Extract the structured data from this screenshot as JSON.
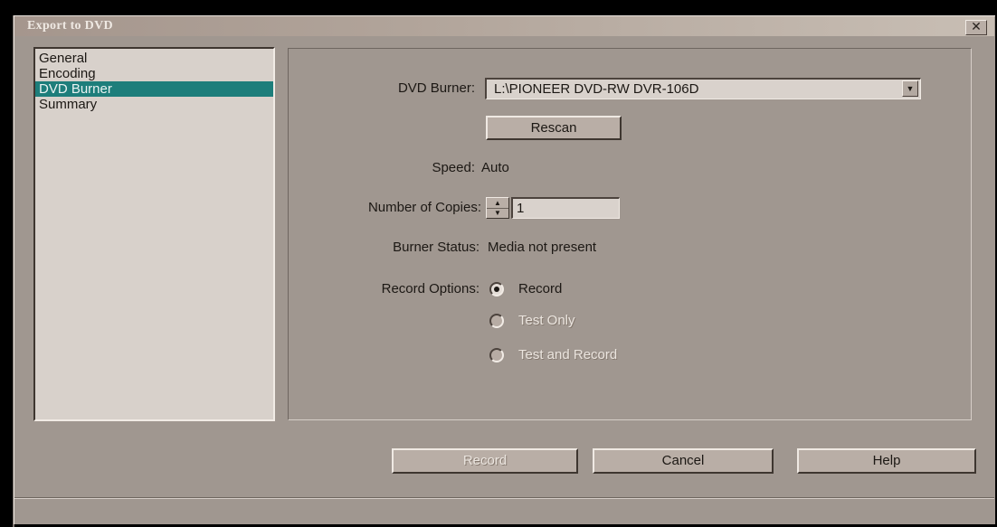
{
  "window": {
    "title": "Export to DVD",
    "close_glyph": "✕"
  },
  "nav": {
    "items": [
      {
        "label": "General",
        "selected": false
      },
      {
        "label": "Encoding",
        "selected": false
      },
      {
        "label": "DVD Burner",
        "selected": true
      },
      {
        "label": "Summary",
        "selected": false
      }
    ]
  },
  "burner": {
    "label": "DVD Burner:",
    "selected_value": "L:\\PIONEER DVD-RW  DVR-106D",
    "rescan_label": "Rescan"
  },
  "speed": {
    "label": "Speed:",
    "value": "Auto"
  },
  "copies": {
    "label": "Number of Copies:",
    "value": "1"
  },
  "status": {
    "label": "Burner Status:",
    "value": "Media not present"
  },
  "record_options": {
    "label": "Record Options:",
    "options": [
      {
        "label": "Record",
        "checked": true,
        "enabled": true
      },
      {
        "label": "Test Only",
        "checked": false,
        "enabled": false
      },
      {
        "label": "Test and Record",
        "checked": false,
        "enabled": false
      }
    ]
  },
  "footer": {
    "record_label": "Record",
    "cancel_label": "Cancel",
    "help_label": "Help"
  },
  "icons": {
    "dropdown": "chevron-down-icon",
    "spin_up": "arrow-up-icon",
    "spin_down": "arrow-down-icon",
    "close": "close-icon"
  },
  "colors": {
    "selection": "#1d7e7b",
    "dialog_bg": "#a09790"
  }
}
